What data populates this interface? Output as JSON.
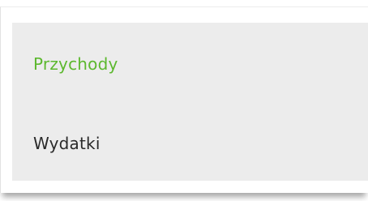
{
  "dropdown": {
    "options": [
      {
        "label": "Przychody",
        "selected": true
      },
      {
        "label": "Wydatki",
        "selected": false
      }
    ]
  },
  "colors": {
    "selected_text": "#5cb82e",
    "text": "#2a2a2a",
    "option_background": "#ececec",
    "panel_background": "#ffffff"
  }
}
